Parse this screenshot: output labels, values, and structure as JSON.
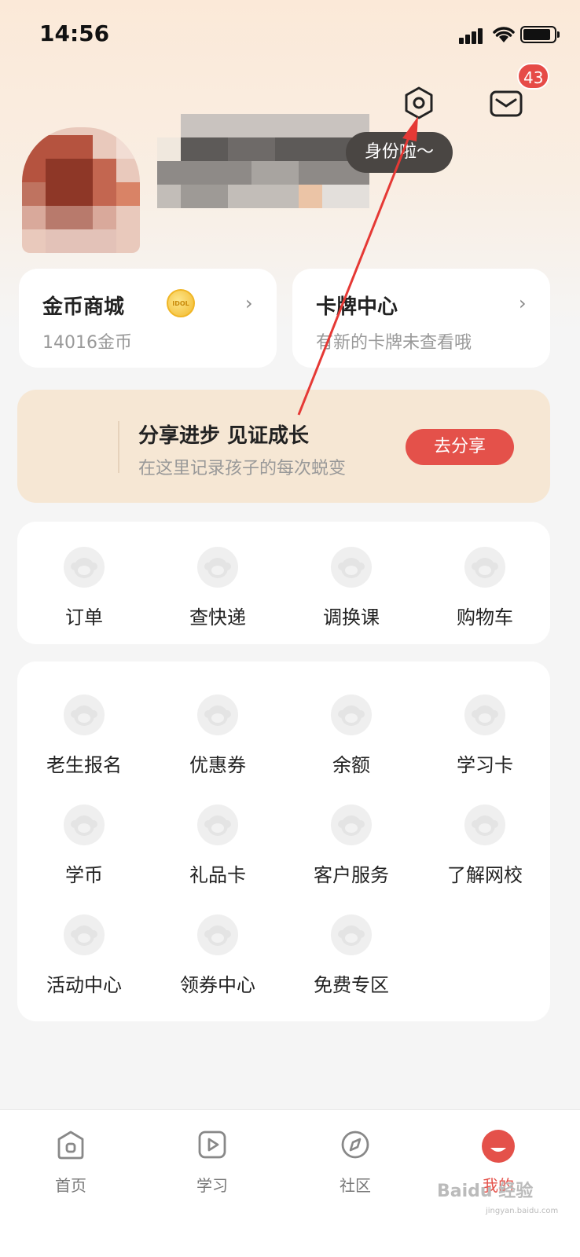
{
  "status_bar": {
    "time": "14:56"
  },
  "header": {
    "message_badge": "43",
    "tip_text": "身份啦～"
  },
  "cards": {
    "coin_mall": {
      "title": "金币商城",
      "subtitle": "14016金币",
      "coin_label": "IDOL"
    },
    "card_center": {
      "title": "卡牌中心",
      "subtitle": "有新的卡牌未查看哦"
    }
  },
  "share": {
    "title": "分享进步 见证成长",
    "subtitle": "在这里记录孩子的每次蜕变",
    "button": "去分享"
  },
  "quick_actions": [
    "订单",
    "查快递",
    "调换课",
    "购物车"
  ],
  "services": [
    "老生报名",
    "优惠券",
    "余额",
    "学习卡",
    "学币",
    "礼品卡",
    "客户服务",
    "了解网校",
    "活动中心",
    "领券中心",
    "免费专区"
  ],
  "tabbar": [
    "首页",
    "学习",
    "社区",
    "我的"
  ],
  "watermark": {
    "main": "Baidu 经验",
    "sub": "jingyan.baidu.com"
  },
  "colors": {
    "accent": "#e4514a",
    "banner": "#f6e7d4",
    "badge": "#e64b47"
  }
}
